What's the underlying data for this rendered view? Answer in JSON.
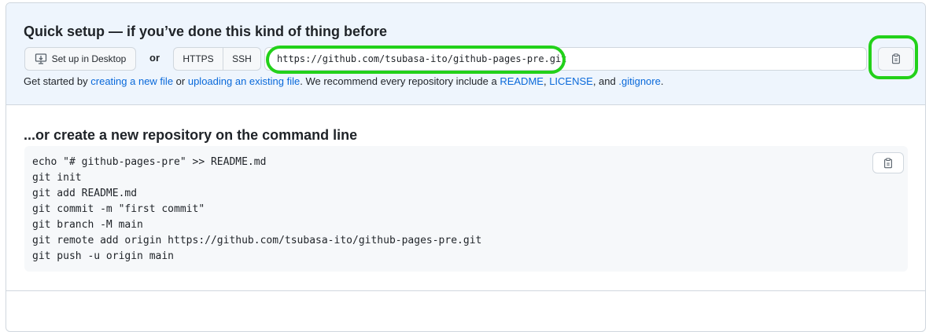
{
  "quick_setup": {
    "title": "Quick setup — if you’ve done this kind of thing before",
    "desktop_button": "Set up in Desktop",
    "or": "or",
    "protocols": [
      "HTTPS",
      "SSH"
    ],
    "clone_url": "https://github.com/tsubasa-ito/github-pages-pre.git",
    "copy_icon": "clipboard-icon",
    "get_started": {
      "t1": "Get started by ",
      "link1": "creating a new file",
      "t2": " or ",
      "link2": "uploading an existing file",
      "t3": ". We recommend every repository include a ",
      "link3": "README",
      "t4": ", ",
      "link4": "LICENSE",
      "t5": ", and ",
      "link5": ".gitignore",
      "t6": "."
    }
  },
  "command_line": {
    "title": "...or create a new repository on the command line",
    "lines": [
      "echo \"# github-pages-pre\" >> README.md",
      "git init",
      "git add README.md",
      "git commit -m \"first commit\"",
      "git branch -M main",
      "git remote add origin https://github.com/tsubasa-ito/github-pages-pre.git",
      "git push -u origin main"
    ]
  },
  "colors": {
    "highlight": "#22d11a",
    "link": "#0969da",
    "quick_bg": "#eef5fd"
  }
}
